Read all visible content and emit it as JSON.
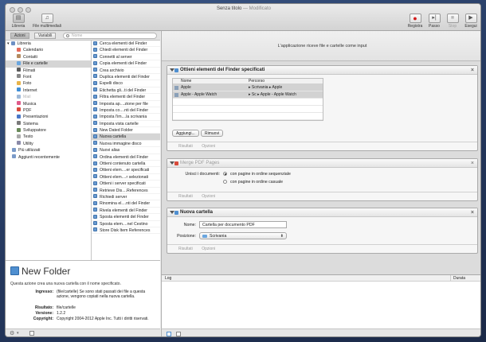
{
  "window": {
    "title": "Senza titolo",
    "subtitle": "— Modificato"
  },
  "toolbar": {
    "left": [
      {
        "label": "Libreria",
        "icon": "library-icon"
      },
      {
        "label": "File multimediali",
        "icon": "music-note-icon"
      }
    ],
    "right": [
      {
        "label": "Registra",
        "icon": "record-icon"
      },
      {
        "label": "Passo",
        "icon": "step-icon"
      },
      {
        "label": "Stop",
        "icon": "stop-icon"
      },
      {
        "label": "Esegui",
        "icon": "play-icon"
      }
    ]
  },
  "library": {
    "tabs": [
      "Azioni",
      "Variabili"
    ],
    "search_placeholder": "Nome",
    "categories": [
      {
        "label": "Libreria",
        "color": "#6d8fc3"
      },
      {
        "label": "Calendario",
        "color": "#e56a5a"
      },
      {
        "label": "Contatti",
        "color": "#b48a5e"
      },
      {
        "label": "File e cartelle",
        "color": "#6aa6df"
      },
      {
        "label": "Filmati",
        "color": "#5a5a5a"
      },
      {
        "label": "Font",
        "color": "#888888"
      },
      {
        "label": "Foto",
        "color": "#e8b44a"
      },
      {
        "label": "Internet",
        "color": "#3f8fd8"
      },
      {
        "label": "Mail",
        "color": "#9fb9d8"
      },
      {
        "label": "Musica",
        "color": "#e05a8a"
      },
      {
        "label": "PDF",
        "color": "#d84a3a"
      },
      {
        "label": "Presentazioni",
        "color": "#4a78c8"
      },
      {
        "label": "Sistema",
        "color": "#7a7a7a"
      },
      {
        "label": "Sviluppatore",
        "color": "#6a8a5a"
      },
      {
        "label": "Testo",
        "color": "#aaaaaa"
      },
      {
        "label": "Utility",
        "color": "#8a8aa8"
      },
      {
        "label": "Più utilizzati",
        "color": "#7a9ac8"
      },
      {
        "label": "Aggiunti recentemente",
        "color": "#7a9ac8"
      }
    ],
    "actions": [
      "Cerca elementi del Finder",
      "Chiedi elementi del Finder",
      "Connetti al server",
      "Copia elementi del Finder",
      "Crea archivio",
      "Duplica elementi del Finder",
      "Espelli disco",
      "Etichetta gli...ti del Finder",
      "Filtra elementi del Finder",
      "Imposta ap....zione per file",
      "Imposta co....nti del Finder",
      "Imposta l'im....la scrivania",
      "Imposta vista cartelle",
      "New Dated Folder",
      "Nuova cartella",
      "Nuova immagine disco",
      "Nuovi alias",
      "Ordina elementi del Finder",
      "Ottieni contenuto cartella",
      "Ottieni elem....er specificati",
      "Ottieni elem....r selezionati",
      "Ottieni i server specificati",
      "Retrieve Dis....References",
      "Richiedi server",
      "Rinomina el....nti del Finder",
      "Rivela elementi del Finder",
      "Sposta elementi del Finder",
      "Sposta elem....nel Cestino",
      "Store Disk Item References"
    ]
  },
  "description": {
    "title": "New Folder",
    "text": "Questa azione crea una nuova cartella con il nome specificato.",
    "input_label": "Ingresso:",
    "input_value": "(file/cartelle) Se sono stati passati dei file a questa azione, vengono copiati nella nuova cartella.",
    "result_label": "Risultato:",
    "result_value": "file/cartelle",
    "version_label": "Versione:",
    "version_value": "1.2.2",
    "copyright_label": "Copyright:",
    "copyright_value": "Copyright 2004-2012 Apple Inc. Tutti i diritti riservati."
  },
  "workflow": {
    "header": "L'applicazione riceve file e cartelle come input",
    "results_label": "Risultati",
    "options_label": "Opzioni",
    "action1": {
      "title": "Ottieni elementi del Finder specificati",
      "col_name": "Nome",
      "col_path": "Percorso",
      "rows": [
        {
          "name": "Apple",
          "path": "▸ Scrivania ▸ Apple"
        },
        {
          "name": "Apple - Apple Watch",
          "path": "▸ Sc ▸ Apple - Apple Watch"
        }
      ],
      "add_button": "Aggiungi...",
      "remove_button": "Rimuovi"
    },
    "action2": {
      "title": "Merge PDF Pages",
      "label": "Unisci i documenti:",
      "opt1": "con pagine in ordine sequenziale",
      "opt2": "con pagine in ordine casuale"
    },
    "action3": {
      "title": "Nuova cartella",
      "name_label": "Nome:",
      "name_value": "Cartella per documento PDF",
      "location_label": "Posizione:",
      "location_value": "Scrivania"
    }
  },
  "log": {
    "col_log": "Log",
    "col_duration": "Durata"
  }
}
